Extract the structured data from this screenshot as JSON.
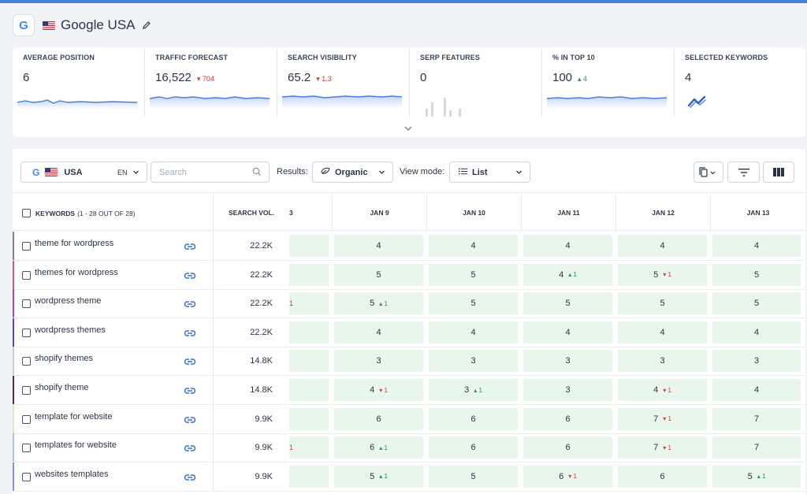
{
  "header": {
    "title": "Google USA"
  },
  "metrics": [
    {
      "label": "AVERAGE POSITION",
      "value": "6",
      "delta": "",
      "dir": ""
    },
    {
      "label": "TRAFFIC FORECAST",
      "value": "16,522",
      "delta": "▾ 704",
      "dir": "down"
    },
    {
      "label": "SEARCH VISIBILITY",
      "value": "65.2",
      "delta": "▾ 1.3",
      "dir": "down"
    },
    {
      "label": "SERP FEATURES",
      "value": "0",
      "delta": "",
      "dir": ""
    },
    {
      "label": "% IN TOP 10",
      "value": "100",
      "delta": "▴ 4",
      "dir": "up"
    },
    {
      "label": "SELECTED KEYWORDS",
      "value": "4",
      "delta": "",
      "dir": ""
    }
  ],
  "toolbar": {
    "location": "USA",
    "language": "EN",
    "search_placeholder": "Search",
    "results_label": "Results:",
    "results_value": "Organic",
    "viewmode_label": "View mode:",
    "viewmode_value": "List"
  },
  "table": {
    "keywords_header": "KEYWORDS",
    "keywords_count": "(1 - 28 OUT OF 28)",
    "volume_header": "SEARCH VOL.",
    "partial_date_header": "3",
    "dates": [
      "JAN 9",
      "JAN 10",
      "JAN 11",
      "JAN 12",
      "JAN 13"
    ],
    "rows": [
      {
        "keyword": "theme for wordpress",
        "volume": "22.2K",
        "bar": "#8a7f86",
        "partial": "",
        "cells": [
          {
            "v": "4",
            "d": ""
          },
          {
            "v": "4",
            "d": ""
          },
          {
            "v": "4",
            "d": ""
          },
          {
            "v": "4",
            "d": ""
          },
          {
            "v": "4",
            "d": ""
          }
        ]
      },
      {
        "keyword": "themes for wordpress",
        "volume": "22.2K",
        "bar": "#d0577b",
        "partial": "",
        "cells": [
          {
            "v": "5",
            "d": ""
          },
          {
            "v": "5",
            "d": ""
          },
          {
            "v": "4",
            "d": "▴ 1"
          },
          {
            "v": "5",
            "d": "▾ 1"
          },
          {
            "v": "5",
            "d": ""
          }
        ]
      },
      {
        "keyword": "wordpress theme",
        "volume": "22.2K",
        "bar": "#a64aa0",
        "partial": "1",
        "cells": [
          {
            "v": "5",
            "d": "▴ 1"
          },
          {
            "v": "5",
            "d": ""
          },
          {
            "v": "5",
            "d": ""
          },
          {
            "v": "5",
            "d": ""
          },
          {
            "v": "5",
            "d": ""
          }
        ]
      },
      {
        "keyword": "wordpress themes",
        "volume": "22.2K",
        "bar": "#5b43c9",
        "partial": "",
        "cells": [
          {
            "v": "4",
            "d": ""
          },
          {
            "v": "4",
            "d": ""
          },
          {
            "v": "4",
            "d": ""
          },
          {
            "v": "4",
            "d": ""
          },
          {
            "v": "4",
            "d": ""
          }
        ]
      },
      {
        "keyword": "shopify themes",
        "volume": "14.8K",
        "bar": "#c9ced8",
        "partial": "",
        "cells": [
          {
            "v": "3",
            "d": ""
          },
          {
            "v": "3",
            "d": ""
          },
          {
            "v": "3",
            "d": ""
          },
          {
            "v": "3",
            "d": ""
          },
          {
            "v": "3",
            "d": ""
          }
        ]
      },
      {
        "keyword": "shopify theme",
        "volume": "14.8K",
        "bar": "#5a2a48",
        "partial": "",
        "cells": [
          {
            "v": "4",
            "d": "▾ 1"
          },
          {
            "v": "3",
            "d": "▴ 1"
          },
          {
            "v": "3",
            "d": ""
          },
          {
            "v": "4",
            "d": "▾ 1"
          },
          {
            "v": "4",
            "d": ""
          }
        ]
      },
      {
        "keyword": "template for website",
        "volume": "9.9K",
        "bar": "#dfe7c8",
        "partial": "",
        "cells": [
          {
            "v": "6",
            "d": ""
          },
          {
            "v": "6",
            "d": ""
          },
          {
            "v": "6",
            "d": ""
          },
          {
            "v": "7",
            "d": "▾ 1"
          },
          {
            "v": "7",
            "d": ""
          }
        ]
      },
      {
        "keyword": "templates for website",
        "volume": "9.9K",
        "bar": "#b7c3e6",
        "partial": "1",
        "cells": [
          {
            "v": "6",
            "d": "▴ 1"
          },
          {
            "v": "6",
            "d": ""
          },
          {
            "v": "6",
            "d": ""
          },
          {
            "v": "7",
            "d": "▾ 1"
          },
          {
            "v": "7",
            "d": ""
          }
        ]
      },
      {
        "keyword": "websites templates",
        "volume": "9.9K",
        "bar": "#8c8fd8",
        "partial": "",
        "cells": [
          {
            "v": "5",
            "d": "▴ 1"
          },
          {
            "v": "5",
            "d": ""
          },
          {
            "v": "6",
            "d": "▾ 1"
          },
          {
            "v": "6",
            "d": ""
          },
          {
            "v": "5",
            "d": "▴ 1"
          }
        ]
      }
    ]
  }
}
